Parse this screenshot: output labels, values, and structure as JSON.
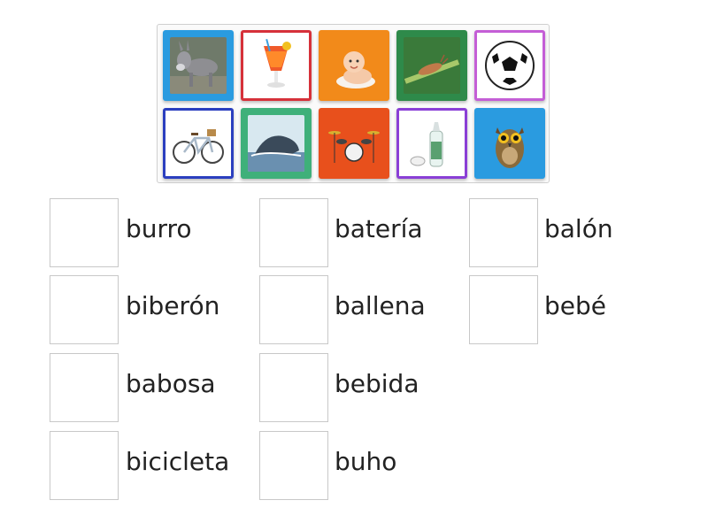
{
  "tiles": [
    {
      "icon": "donkey-icon",
      "border": "#2a9be0",
      "bg": "#2a9be0"
    },
    {
      "icon": "cocktail-drink-icon",
      "border": "#d6313a",
      "bg": "#ffffff"
    },
    {
      "icon": "baby-icon",
      "border": "#f28a1a",
      "bg": "#f28a1a"
    },
    {
      "icon": "slug-icon",
      "border": "#2e8a4a",
      "bg": "#2e8a4a"
    },
    {
      "icon": "soccer-ball-icon",
      "border": "#c45ed6",
      "bg": "#ffffff"
    },
    {
      "icon": "bicycle-icon",
      "border": "#2b3fbf",
      "bg": "#ffffff"
    },
    {
      "icon": "whale-icon",
      "border": "#3fb07a",
      "bg": "#3fb07a"
    },
    {
      "icon": "drum-kit-icon",
      "border": "#e8501c",
      "bg": "#e8501c"
    },
    {
      "icon": "baby-bottle-icon",
      "border": "#8a3fd6",
      "bg": "#ffffff"
    },
    {
      "icon": "owl-icon",
      "border": "#2a9be0",
      "bg": "#2a9be0"
    }
  ],
  "answers": [
    {
      "word": "burro"
    },
    {
      "word": "biberón"
    },
    {
      "word": "babosa"
    },
    {
      "word": "bicicleta"
    },
    {
      "word": "batería"
    },
    {
      "word": "ballena"
    },
    {
      "word": "bebida"
    },
    {
      "word": "buho"
    },
    {
      "word": "balón"
    },
    {
      "word": "bebé"
    }
  ]
}
